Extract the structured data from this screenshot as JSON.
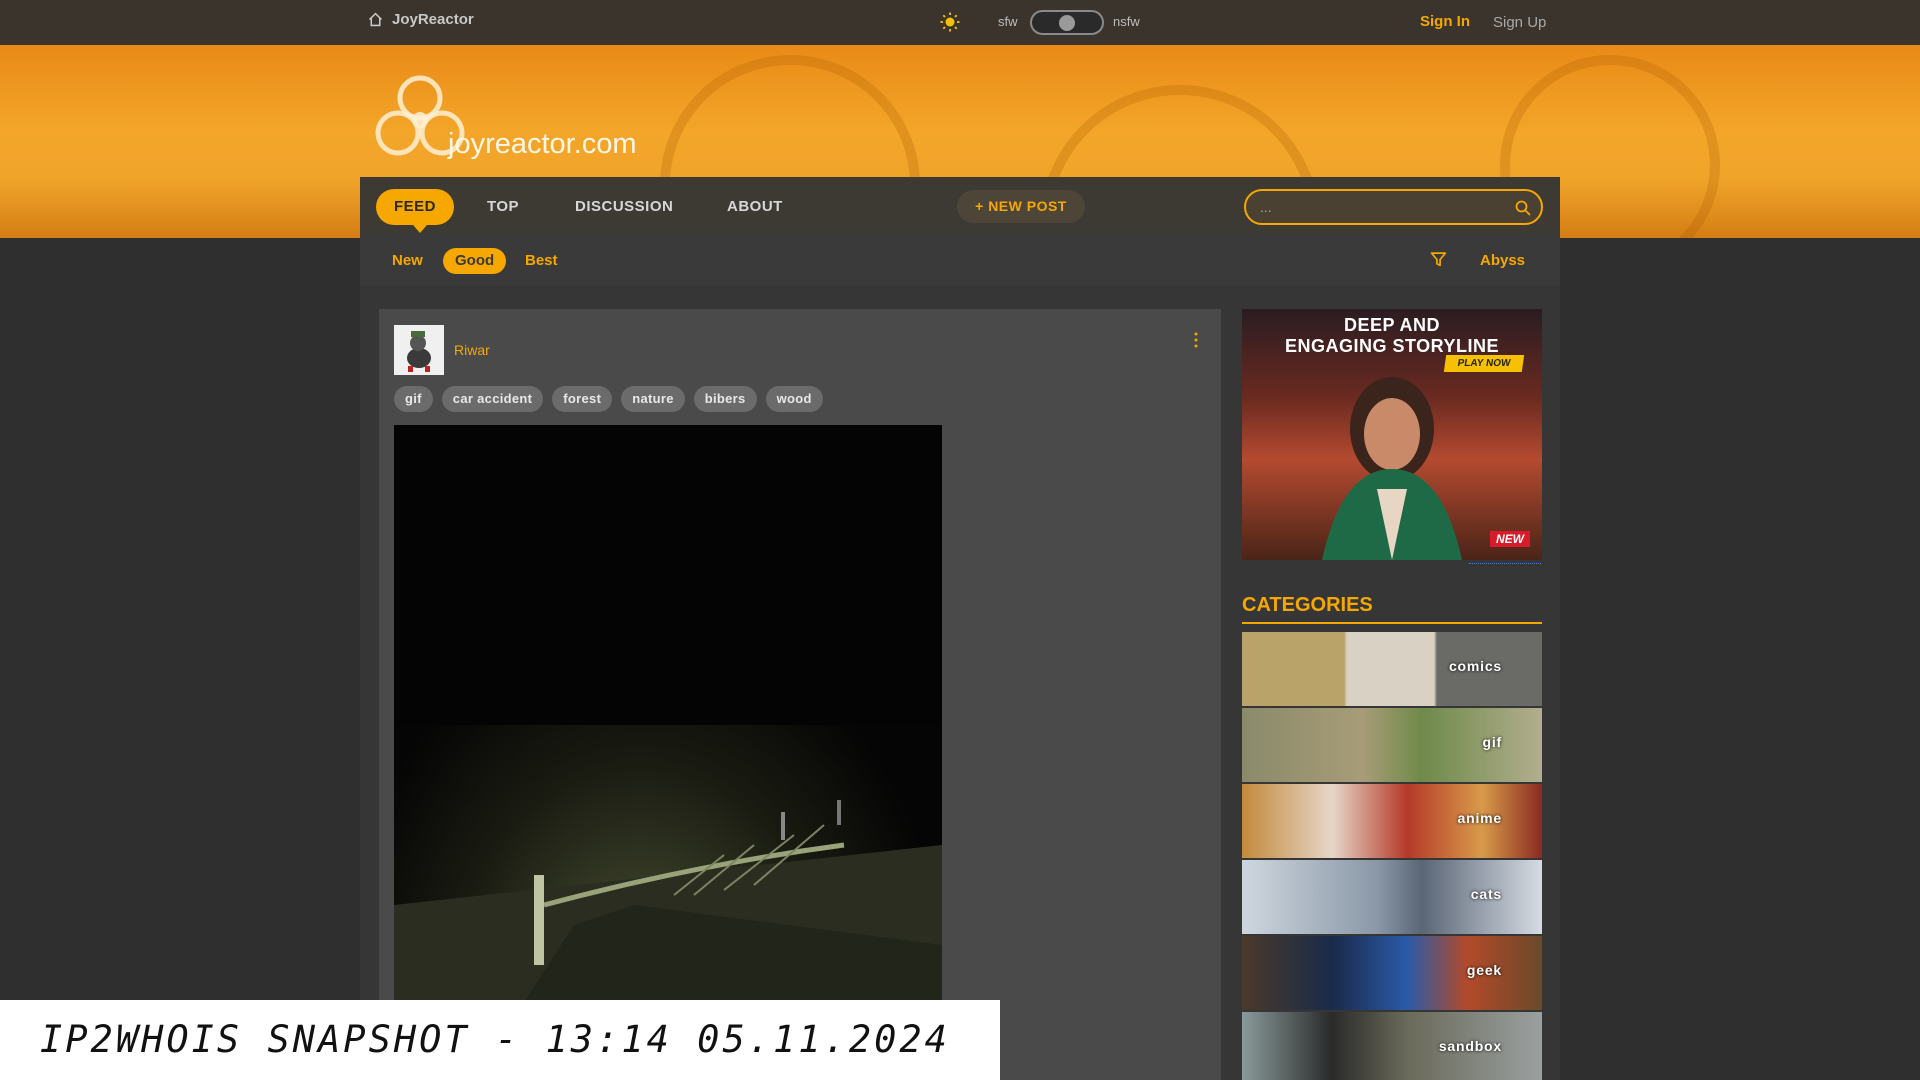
{
  "topbar": {
    "home_label": "JoyReactor",
    "sfw_label": "sfw",
    "nsfw_label": "nsfw",
    "sign_in": "Sign In",
    "sign_up": "Sign Up"
  },
  "banner": {
    "site_name": "joyreactor.com"
  },
  "main_nav": {
    "items": [
      {
        "label": "FEED",
        "active": true
      },
      {
        "label": "TOP",
        "active": false
      },
      {
        "label": "DISCUSSION",
        "active": false
      },
      {
        "label": "ABOUT",
        "active": false
      }
    ],
    "new_post": "+ NEW POST",
    "search_placeholder": "..."
  },
  "sub_nav": {
    "items": [
      {
        "label": "New",
        "active": false
      },
      {
        "label": "Good",
        "active": true
      },
      {
        "label": "Best",
        "active": false
      }
    ],
    "abyss": "Abyss"
  },
  "post": {
    "username": "Riwar",
    "tags": [
      "gif",
      "car accident",
      "forest",
      "nature",
      "bibers",
      "wood"
    ]
  },
  "ad": {
    "title_line1": "DEEP AND",
    "title_line2": "ENGAGING STORYLINE",
    "play_now": "PLAY NOW",
    "badge": "NEW"
  },
  "sidebar": {
    "categories_title": "CATEGORIES",
    "categories": [
      "comics",
      "gif",
      "anime",
      "cats",
      "geek",
      "sandbox"
    ]
  },
  "watermark": {
    "text": "IP2WHOIS SNAPSHOT - 13:14 05.11.2024"
  },
  "colors": {
    "accent": "#f6a800",
    "topbar": "#3a342c",
    "page_bg": "#2f2f2f",
    "post_bg": "#4a4a4a"
  }
}
